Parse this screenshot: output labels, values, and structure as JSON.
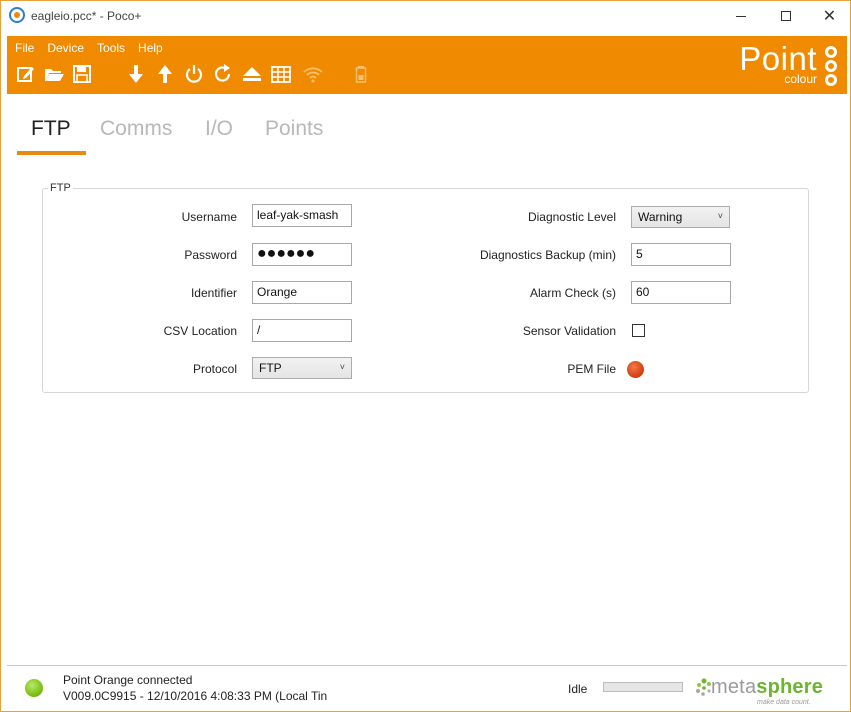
{
  "window": {
    "title": "eagleio.pcc* - Poco+",
    "minimize_icon": "minimize-icon",
    "maximize_icon": "maximize-icon",
    "close_icon": "close-icon",
    "close_glyph": "✕"
  },
  "menu": [
    "File",
    "Device",
    "Tools",
    "Help"
  ],
  "toolbar": {
    "icons": [
      "new-icon",
      "open-folder-icon",
      "save-icon",
      "download-icon",
      "upload-icon",
      "power-icon",
      "refresh-icon",
      "eject-icon",
      "grid-icon",
      "wifi-icon",
      "battery-icon"
    ]
  },
  "logo": {
    "word": "Point",
    "sub": "colour"
  },
  "tabs": [
    {
      "label": "FTP",
      "active": true
    },
    {
      "label": "Comms",
      "active": false
    },
    {
      "label": "I/O",
      "active": false
    },
    {
      "label": "Points",
      "active": false
    }
  ],
  "ftp": {
    "legend": "FTP",
    "username": {
      "label": "Username",
      "value": "leaf-yak-smash"
    },
    "password": {
      "label": "Password",
      "value": "●●●●●●"
    },
    "identifier": {
      "label": "Identifier",
      "value": "Orange"
    },
    "csv_location": {
      "label": "CSV Location",
      "value": "/"
    },
    "protocol": {
      "label": "Protocol",
      "value": "FTP"
    },
    "diagnostic_level": {
      "label": "Diagnostic Level",
      "value": "Warning"
    },
    "diagnostics_backup": {
      "label": "Diagnostics Backup (min)",
      "value": "5"
    },
    "alarm_check": {
      "label": "Alarm Check (s)",
      "value": "60"
    },
    "sensor_validation": {
      "label": "Sensor Validation",
      "checked": false
    },
    "pem_file": {
      "label": "PEM File"
    }
  },
  "status": {
    "line1": "Point Orange connected",
    "line2": "V009.0C9915 - 12/10/2016 4:08:33 PM (Local Tin",
    "idle": "Idle",
    "progress": 0,
    "brand_prefix": "meta",
    "brand_suffix": "sphere",
    "tagline": "make data count.",
    "colors": {
      "connected": "#7dc215",
      "accent": "#f08a00",
      "pem": "#d84315"
    }
  }
}
